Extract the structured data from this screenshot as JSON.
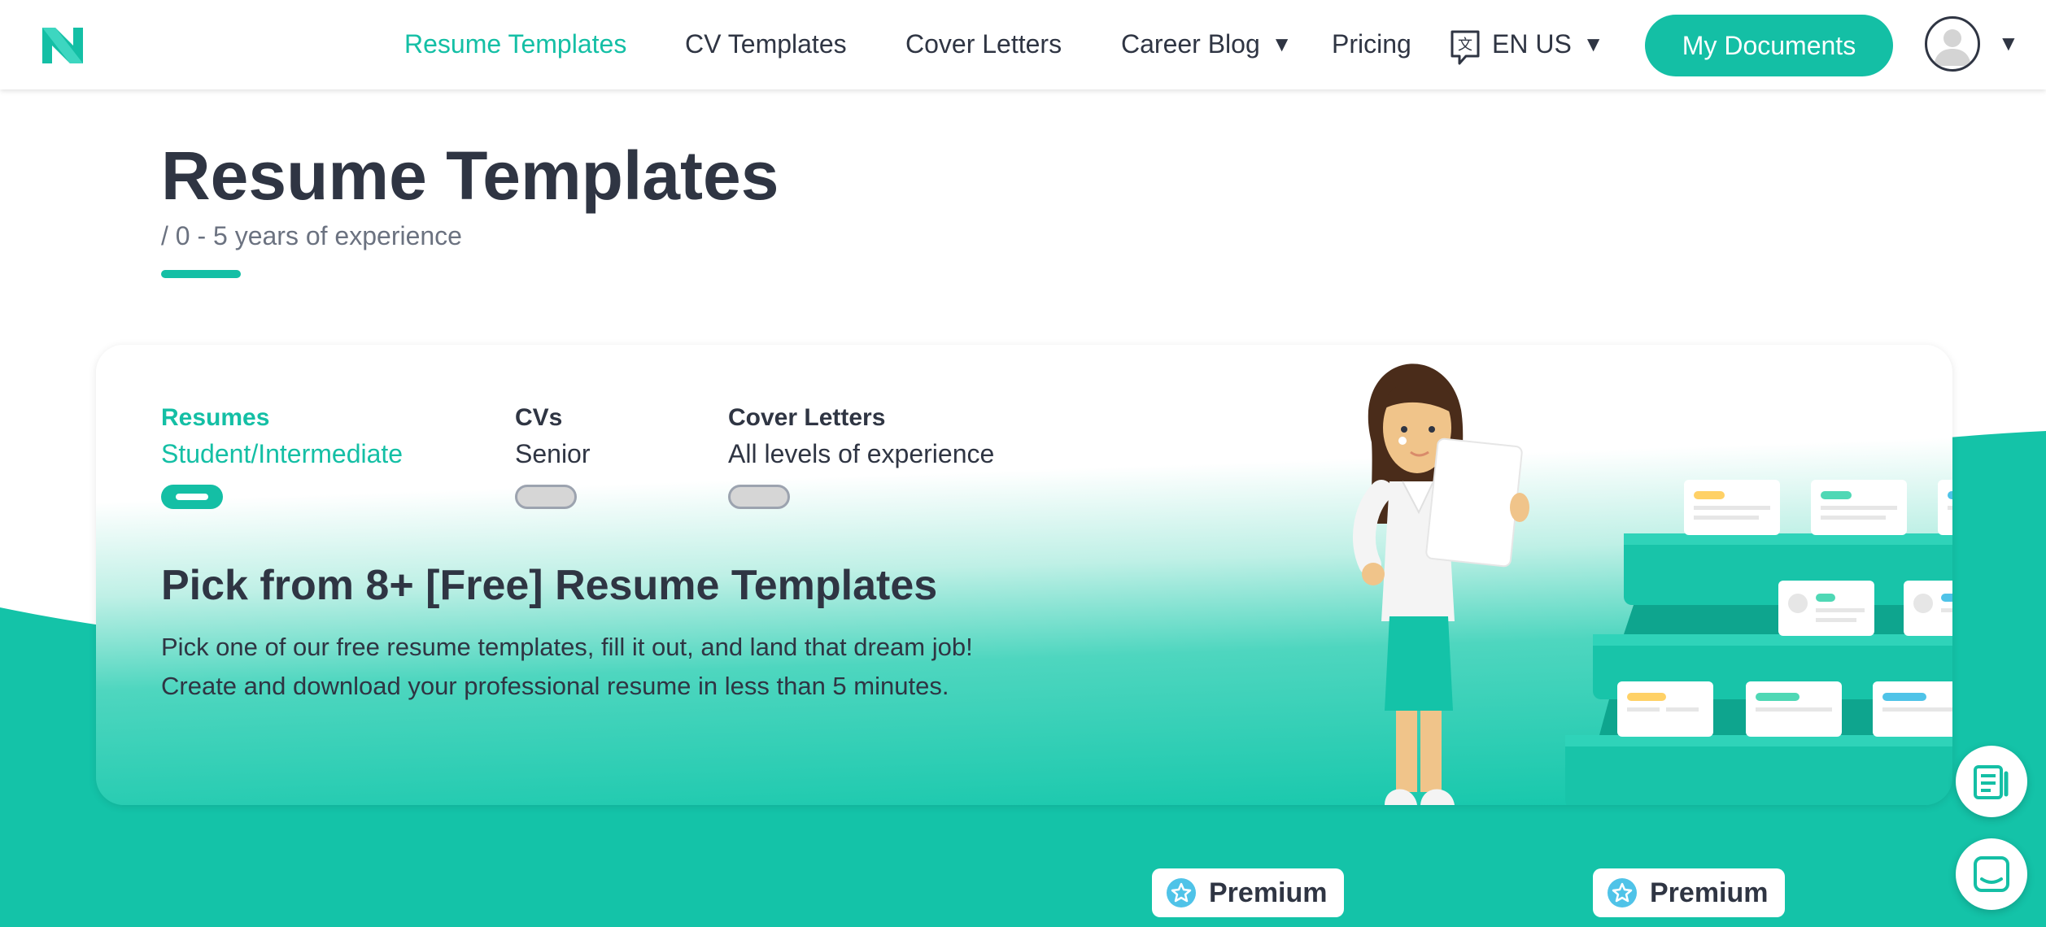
{
  "nav": {
    "links": [
      {
        "label": "Resume Templates"
      },
      {
        "label": "CV Templates"
      },
      {
        "label": "Cover Letters"
      },
      {
        "label": "Career Blog"
      },
      {
        "label": "Pricing"
      }
    ],
    "language": "EN US",
    "my_documents": "My Documents",
    "icons": {
      "logo": "novoresume-logo",
      "language": "translate-icon",
      "caret": "caret-down-icon",
      "avatar": "user-avatar-icon"
    }
  },
  "page": {
    "title": "Resume Templates",
    "subtitle": "/ 0 - 5 years of experience"
  },
  "card": {
    "tabs": [
      {
        "label": "Resumes",
        "desc": "Student/Intermediate",
        "active": true
      },
      {
        "label": "CVs",
        "desc": "Senior",
        "active": false
      },
      {
        "label": "Cover Letters",
        "desc": "All levels of experience",
        "active": false
      }
    ],
    "heading": "Pick from 8+ [Free] Resume Templates",
    "description": "Pick one of our free resume templates, fill it out, and land that dream job! Create and download your professional resume in less than 5 minutes."
  },
  "badges": [
    {
      "label": "Premium"
    },
    {
      "label": "Premium"
    }
  ],
  "floating": {
    "icons": [
      "document-icon",
      "chat-icon"
    ]
  },
  "colors": {
    "accent": "#14bfa5",
    "text": "#2f3543",
    "muted": "#6b7280",
    "badge_star": "#4fc3e8"
  }
}
